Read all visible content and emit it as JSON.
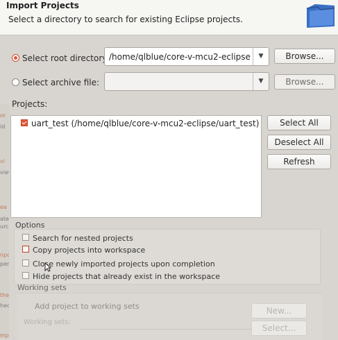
{
  "header": {
    "title": "Import Projects",
    "description": "Select a directory to search for existing Eclipse projects."
  },
  "root_directory": {
    "label": "Select root directory:",
    "selected": true,
    "value": "/home/qlblue/core-v-mcu2-eclipse",
    "browse_label": "Browse..."
  },
  "archive_file": {
    "label": "Select archive file:",
    "selected": false,
    "value": "",
    "browse_label": "Browse..."
  },
  "projects": {
    "label": "Projects:",
    "items": [
      {
        "label": "uart_test (/home/qlblue/core-v-mcu2-eclipse/uart_test)",
        "checked": true
      }
    ],
    "select_all_label": "Select All",
    "deselect_all_label": "Deselect All",
    "refresh_label": "Refresh"
  },
  "options": {
    "label": "Options",
    "search_nested": {
      "label": "Search for nested projects",
      "checked": false
    },
    "copy_into_workspace": {
      "label": "Copy projects into workspace",
      "checked": true
    },
    "close_after_import": {
      "label": "Close newly imported projects upon completion",
      "checked": false
    },
    "hide_existing": {
      "label": "Hide projects that already exist in the workspace",
      "checked": false
    }
  },
  "working_sets": {
    "label": "Working sets",
    "add_label": "Add project to working sets",
    "field_label": "Working sets:",
    "new_label": "New...",
    "select_label": "Select..."
  },
  "background_left": {
    "snippets": [
      "or",
      "id",
      "vi",
      "view",
      "ea",
      "ate",
      "urce",
      "npo",
      "pen",
      "the",
      "heck",
      "mpo"
    ]
  },
  "colors": {
    "accent": "#e2563a",
    "header_bg": "#f6f6f3",
    "dialog_bg": "#d8d5d0"
  }
}
